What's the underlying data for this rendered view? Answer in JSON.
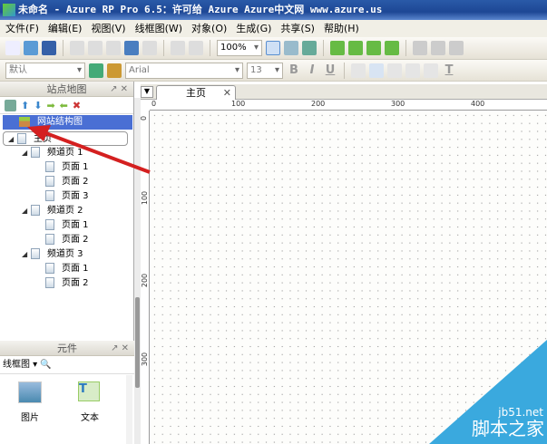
{
  "window": {
    "title": "未命名 - Azure RP Pro 6.5：许可给 Azure Azure中文网 www.azure.us"
  },
  "menu": [
    "文件(F)",
    "编辑(E)",
    "视图(V)",
    "线框图(W)",
    "对象(O)",
    "生成(G)",
    "共享(S)",
    "帮助(H)"
  ],
  "toolbar": {
    "zoom": "100%",
    "style": "默认",
    "font": "Arial",
    "size": "13",
    "bold": "B",
    "italic": "I",
    "underline": "U",
    "text_color": "T"
  },
  "sitemap": {
    "title": "站点地图",
    "root_label": "网站结构图",
    "tree": [
      {
        "label": "主页",
        "level": 0
      },
      {
        "label": "频道页 1",
        "level": 1
      },
      {
        "label": "页面 1",
        "level": 2
      },
      {
        "label": "页面 2",
        "level": 2
      },
      {
        "label": "页面 3",
        "level": 2
      },
      {
        "label": "频道页 2",
        "level": 1
      },
      {
        "label": "页面 1",
        "level": 2
      },
      {
        "label": "页面 2",
        "level": 2
      },
      {
        "label": "频道页 3",
        "level": 1
      },
      {
        "label": "页面 1",
        "level": 2
      },
      {
        "label": "页面 2",
        "level": 2
      }
    ]
  },
  "canvas": {
    "tab": "主页",
    "hruler": [
      "0",
      "100",
      "200",
      "300",
      "400"
    ],
    "vruler": [
      "0",
      "100",
      "200",
      "300"
    ]
  },
  "widgets": {
    "title": "元件",
    "library": "线框图",
    "items": [
      {
        "label": "图片"
      },
      {
        "label": "文本"
      }
    ]
  },
  "watermark": {
    "site": "jb51.net",
    "name": "脚本之家",
    "color": "#3aa9de"
  },
  "colors": {
    "titlebar": "#1d4795",
    "selection": "#4a6fd4",
    "arrow": "#d42020"
  }
}
